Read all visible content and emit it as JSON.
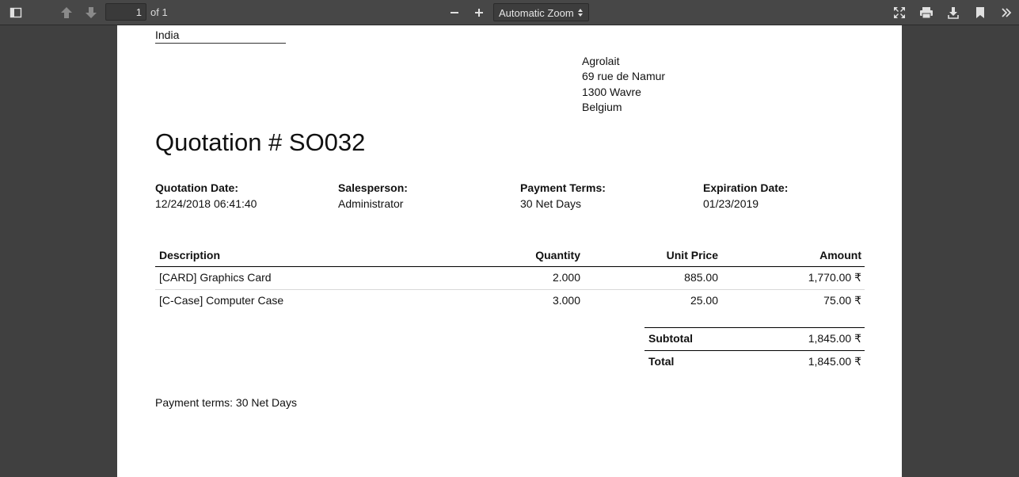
{
  "toolbar": {
    "page_number": "1",
    "page_of": "of 1",
    "zoom": "Automatic Zoom"
  },
  "document": {
    "partial_address_last_line": "India",
    "customer_address": [
      "Agrolait",
      "69 rue de Namur",
      "1300 Wavre",
      "Belgium"
    ],
    "title": "Quotation # SO032",
    "info": [
      {
        "label": "Quotation Date:",
        "value": "12/24/2018 06:41:40"
      },
      {
        "label": "Salesperson:",
        "value": "Administrator"
      },
      {
        "label": "Payment Terms:",
        "value": "30 Net Days"
      },
      {
        "label": "Expiration Date:",
        "value": "01/23/2019"
      }
    ],
    "table": {
      "headers": [
        "Description",
        "Quantity",
        "Unit Price",
        "Amount"
      ],
      "rows": [
        [
          "[CARD] Graphics Card",
          "2.000",
          "885.00",
          "1,770.00 ₹"
        ],
        [
          "[C-Case] Computer Case",
          "3.000",
          "25.00",
          "75.00 ₹"
        ]
      ]
    },
    "totals": [
      {
        "label": "Subtotal",
        "value": "1,845.00 ₹"
      },
      {
        "label": "Total",
        "value": "1,845.00 ₹"
      }
    ],
    "payment_note": "Payment terms: 30 Net Days"
  }
}
